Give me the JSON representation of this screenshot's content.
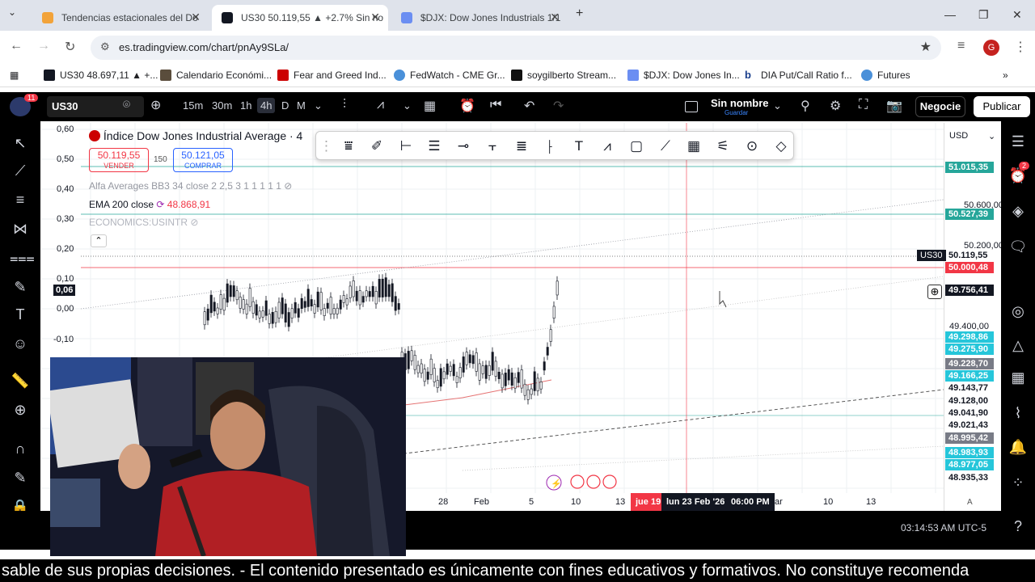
{
  "browser": {
    "tabs": [
      {
        "title": "Tendencias estacionales del Do"
      },
      {
        "title": "US30 50.119,55 ▲ +2.7% Sin no"
      },
      {
        "title": "$DJX: Dow Jones Industrials 1/1"
      }
    ],
    "url": "es.tradingview.com/chart/pnAy9SLa/",
    "profile_initial": "G",
    "bookmarks": [
      "US30 48.697,11 ▲ +...",
      "Calendario Económi...",
      "Fear and Greed Ind...",
      "FedWatch - CME Gr...",
      "soygilberto Stream...",
      "$DJX: Dow Jones In...",
      "DIA Put/Call Ratio f...",
      "Futures"
    ]
  },
  "toolbar": {
    "badge": "11",
    "symbol": "US30",
    "intervals": [
      "15m",
      "30m",
      "1h",
      "4h",
      "D",
      "M"
    ],
    "active_interval": "4h",
    "layout_name": "Sin nombre",
    "layout_sub": "Guardar",
    "trade_label": "Negocie",
    "publish_label": "Publicar"
  },
  "legend": {
    "title": "Índice Dow Jones Industrial Average · 4",
    "sell_price": "50.119,55",
    "sell_label": "VENDER",
    "spread": "150",
    "buy_price": "50.121,05",
    "buy_label": "COMPRAR",
    "alfa": "Alfa Averages BB3 34 close 2 2,5 3 1 1 1 1 1",
    "ema_label": "EMA 200 close",
    "ema_value": "48.868,91",
    "economics": "ECONOMICS:USINTR"
  },
  "left_scale": [
    "0,60",
    "0,50",
    "0,40",
    "0,30",
    "0,20",
    "0,10",
    "0,00",
    "-0,10"
  ],
  "left_scale_current": "0,06",
  "price_scale": {
    "currency": "USD",
    "ticks": [
      "50.600,00",
      "50.200,00",
      "49.400,00"
    ],
    "labels": [
      {
        "text": "51.015,35",
        "color": "#26a69a"
      },
      {
        "text": "50.527,39",
        "color": "#26a69a"
      },
      {
        "text": "50.119,55",
        "color": "#131722"
      },
      {
        "text": "50.000,48",
        "color": "#f23645"
      },
      {
        "text": "49.756,41",
        "color": "#131722"
      },
      {
        "text": "49.298,86",
        "color": "#26c6da"
      },
      {
        "text": "49.275,90",
        "color": "#26c6da"
      },
      {
        "text": "49.228,70",
        "color": "#787b86"
      },
      {
        "text": "49.166,25",
        "color": "#26c6da"
      },
      {
        "text": "49.143,77",
        "color": "#ffffff"
      },
      {
        "text": "49.128,00",
        "color": "#ffffff"
      },
      {
        "text": "49.041,90",
        "color": "#ffffff"
      },
      {
        "text": "49.021,43",
        "color": "#ffffff"
      },
      {
        "text": "48.995,42",
        "color": "#787b86"
      },
      {
        "text": "48.983,93",
        "color": "#26c6da"
      },
      {
        "text": "48.977,05",
        "color": "#26c6da"
      },
      {
        "text": "48.935,33",
        "color": "#ffffff"
      }
    ],
    "symbol_tag": "US30"
  },
  "x_axis": [
    "28",
    "Feb",
    "5",
    "10",
    "13",
    "10",
    "13"
  ],
  "x_highlight": {
    "left": "jue 19",
    "center": "lun 23 Feb '26",
    "time": "06:00 PM",
    "right": "ar"
  },
  "x_axis_mode": "A",
  "clock": "03:14:53 AM UTC-5",
  "alerts_badge": "2",
  "subtitle": "sable de sus propias decisiones.  - El contenido presentado es únicamente con fines educativos y formativos. No constituye recomenda"
}
